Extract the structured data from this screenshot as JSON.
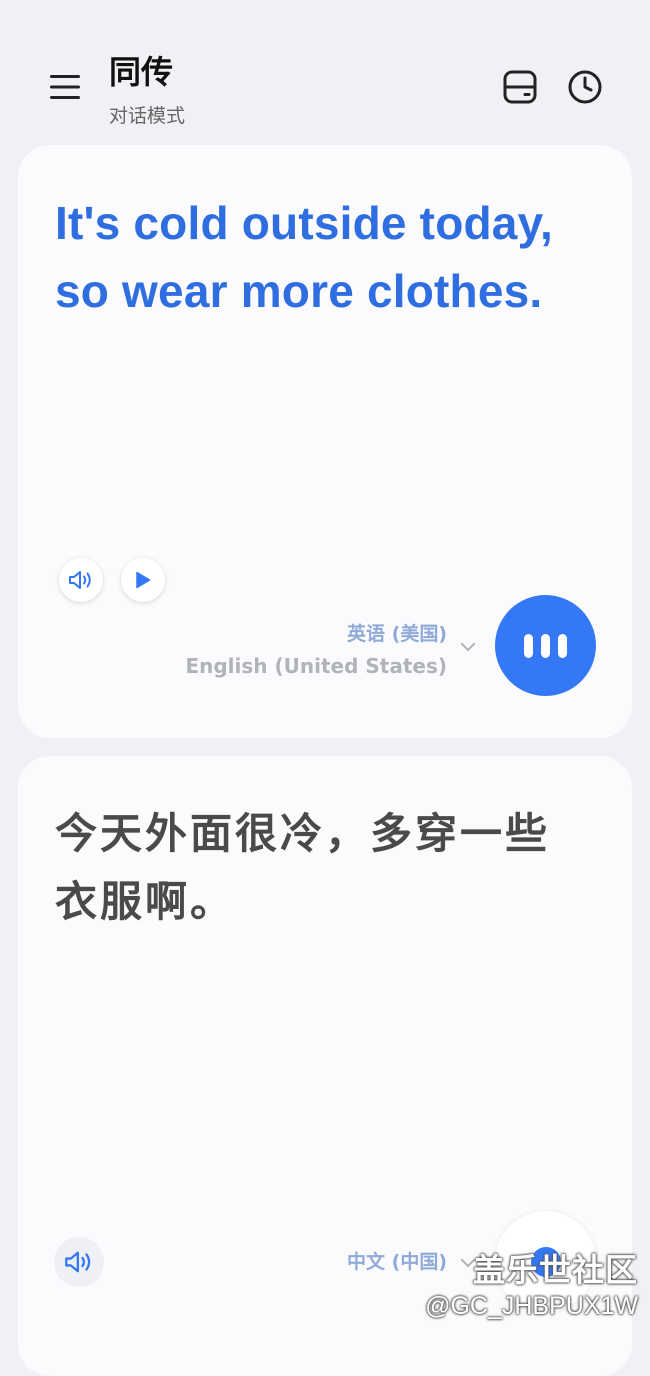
{
  "header": {
    "title": "同传",
    "subtitle": "对话模式",
    "menu_icon": "hamburger-menu-icon",
    "layout_icon": "split-layout-icon",
    "history_icon": "clock-icon"
  },
  "source_card": {
    "text": "It's cold outside today, so wear more clothes.",
    "language_native": "英语 (美国)",
    "language_english": "English (United States)",
    "speaker_icon": "speaker-icon",
    "play_icon": "play-icon",
    "mic_icon": "listening-bars-icon"
  },
  "target_card": {
    "text": "今天外面很冷，多穿一些衣服啊。",
    "language_native": "中文 (中国)",
    "speaker_icon": "speaker-icon"
  },
  "watermark": {
    "line1": "盖乐世社区",
    "line2": "@GC_JHBPUX1W"
  },
  "colors": {
    "accent": "#3478f6",
    "source_text": "#2f6ee0",
    "background": "#f0f1f4",
    "card": "#fbfbfd"
  }
}
